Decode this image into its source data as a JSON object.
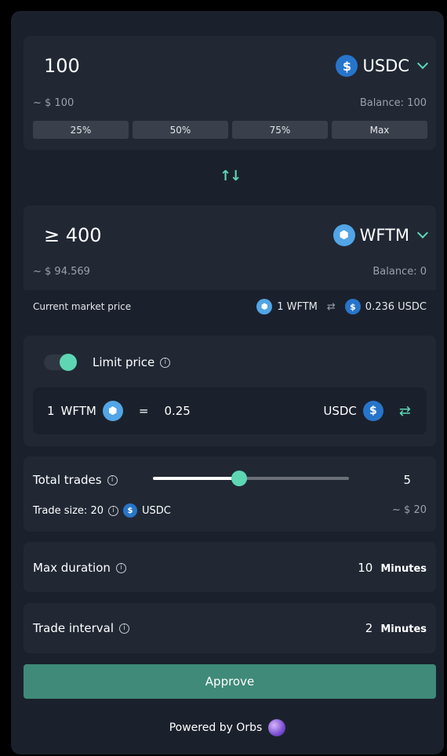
{
  "from": {
    "amount": "100",
    "usd_value": "~ $ 100",
    "balance": "Balance: 100",
    "token": "USDC",
    "token_icon": "usdc-icon",
    "percent_buttons": [
      "25%",
      "50%",
      "75%",
      "Max"
    ]
  },
  "swap_icon": "↑↓",
  "to": {
    "amount": "≥ 400",
    "usd_value": "~ $ 94.569",
    "balance": "Balance: 0",
    "token": "WFTM",
    "token_icon": "wftm-icon"
  },
  "market_price": {
    "label": "Current market price",
    "left": "1 WFTM",
    "right": "0.236 USDC"
  },
  "limit": {
    "label": "Limit price",
    "enabled": true,
    "left_qty": "1",
    "left_token": "WFTM",
    "equals": "=",
    "value": "0.25",
    "right_token": "USDC"
  },
  "trades": {
    "label": "Total trades",
    "value": "5",
    "slider_fraction": 0.44,
    "trade_size_label": "Trade size: 20",
    "trade_size_token": "USDC",
    "trade_size_usd": "~ $ 20"
  },
  "max_duration": {
    "label": "Max duration",
    "value": "10",
    "unit": "Minutes"
  },
  "trade_interval": {
    "label": "Trade interval",
    "value": "2",
    "unit": "Minutes"
  },
  "approve_label": "Approve",
  "powered_by": "Powered by Orbs",
  "colors": {
    "accent": "#5ed6b4",
    "approve": "#3f8a79",
    "card": "#1b212c",
    "panel": "#212834"
  }
}
